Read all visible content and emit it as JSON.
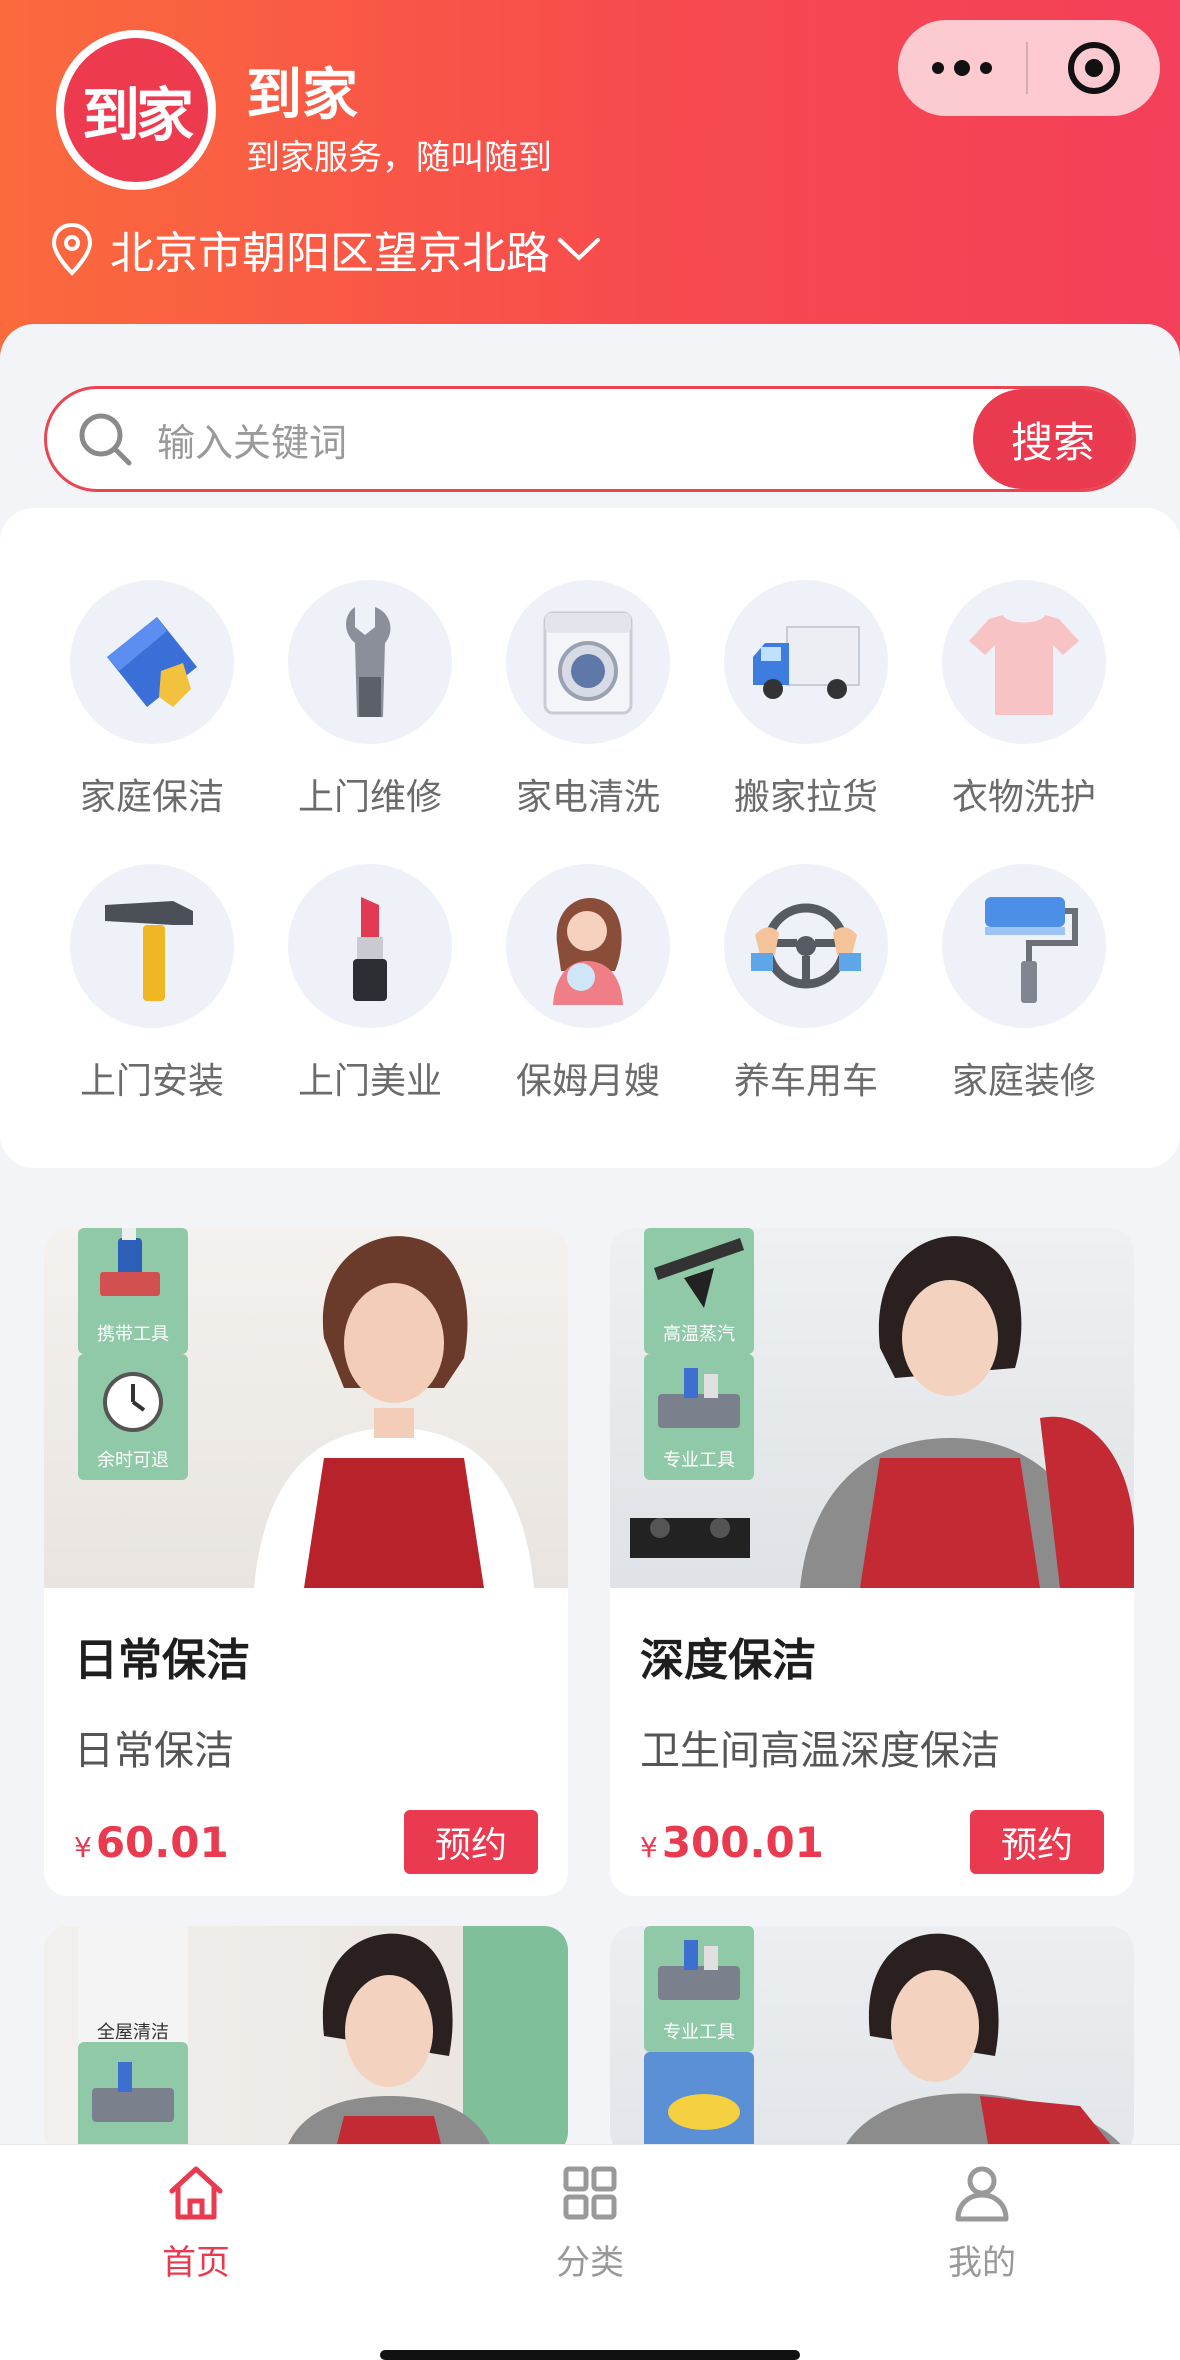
{
  "header": {
    "logo_text": "到家",
    "title": "到家",
    "subtitle": "到家服务，随叫随到",
    "location": "北京市朝阳区望京北路"
  },
  "search": {
    "placeholder": "输入关键词",
    "button_label": "搜索"
  },
  "categories": [
    {
      "label": "家庭保洁",
      "icon": "cleaning-cloth-icon"
    },
    {
      "label": "上门维修",
      "icon": "wrench-icon"
    },
    {
      "label": "家电清洗",
      "icon": "washing-machine-icon"
    },
    {
      "label": "搬家拉货",
      "icon": "truck-icon"
    },
    {
      "label": "衣物洗护",
      "icon": "tshirt-icon"
    },
    {
      "label": "上门安装",
      "icon": "hammer-icon"
    },
    {
      "label": "上门美业",
      "icon": "lipstick-icon"
    },
    {
      "label": "保姆月嫂",
      "icon": "nanny-icon"
    },
    {
      "label": "养车用车",
      "icon": "steering-wheel-icon"
    },
    {
      "label": "家庭装修",
      "icon": "paint-roller-icon"
    }
  ],
  "services": [
    {
      "title": "日常保洁",
      "desc": "日常保洁",
      "currency": "¥",
      "price": "60.01",
      "button": "预约",
      "tags": [
        "携带工具",
        "余时可退"
      ]
    },
    {
      "title": "深度保洁",
      "desc": "卫生间高温深度保洁",
      "currency": "¥",
      "price": "300.01",
      "button": "预约",
      "tags": [
        "高温蒸汽",
        "专业工具"
      ]
    },
    {
      "tags": [
        "全屋清洁",
        ""
      ]
    },
    {
      "tags": [
        "专业工具",
        ""
      ]
    }
  ],
  "tabbar": [
    {
      "label": "首页",
      "icon": "home-icon",
      "active": true
    },
    {
      "label": "分类",
      "icon": "grid-icon",
      "active": false
    },
    {
      "label": "我的",
      "icon": "user-icon",
      "active": false
    }
  ],
  "colors": {
    "accent": "#ea3a4f",
    "header_start": "#fb6a3c",
    "header_end": "#f33f59"
  }
}
